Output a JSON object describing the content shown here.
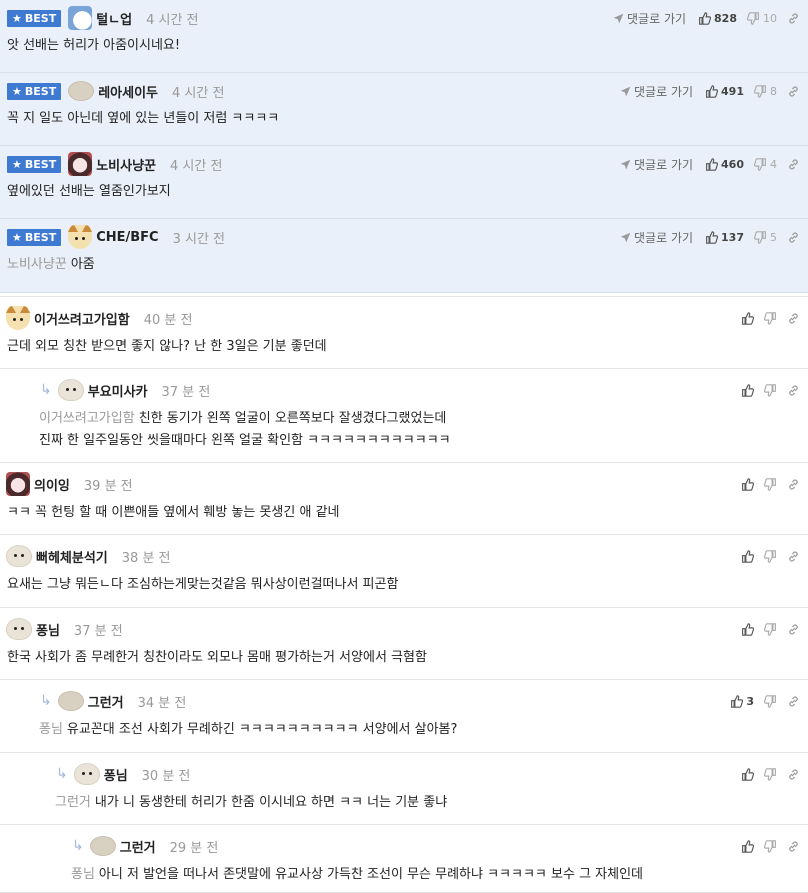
{
  "best_label": "BEST",
  "goto_label": "댓글로 가기",
  "best_comments": [
    {
      "nick": "털ㄴ업",
      "time": "4 시간 전",
      "up": "828",
      "down": "10",
      "text": "앗 선배는 허리가 아줌이시네요!",
      "mention": "",
      "avatar": "polar"
    },
    {
      "nick": "레아세이두",
      "time": "4 시간 전",
      "up": "491",
      "down": "8",
      "text": "꼭 지 일도 아닌데 옆에 있는 년들이 저럼 ㅋㅋㅋㅋ",
      "mention": "",
      "avatar": "blob"
    },
    {
      "nick": "노비사냥꾼",
      "time": "4 시간 전",
      "up": "460",
      "down": "4",
      "text": "옆에있던 선배는 열줌인가보지",
      "mention": "",
      "avatar": "doll"
    },
    {
      "nick": "CHE/BFC",
      "time": "3 시간 전",
      "up": "137",
      "down": "5",
      "text": "아줌",
      "mention": "노비사냥꾼",
      "avatar": "fox"
    }
  ],
  "comments": [
    {
      "nick": "이거쓰려고가입함",
      "time": "40 분 전",
      "text": "근데 외모 칭찬 받으면 좋지 않나? 난 한 3일은 기분 좋던데",
      "mention": "",
      "avatar": "fox",
      "depth": 0,
      "up": ""
    },
    {
      "nick": "부요미사카",
      "time": "37 분 전",
      "text": "친한 동기가 왼쪽 얼굴이 오른쪽보다 잘생겼다그랬었는데",
      "text2": "진짜 한 일주일동안 씻을때마다 왼쪽 얼굴 확인함 ㅋㅋㅋㅋㅋㅋㅋㅋㅋㅋㅋㅋ",
      "mention": "이거쓰려고가입함",
      "avatar": "puppy",
      "depth": 1,
      "up": ""
    },
    {
      "nick": "의이잉",
      "time": "39 분 전",
      "text": "ㅋㅋ 꼭 헌팅 할 때 이쁜애들 옆에서 훼방 놓는 못생긴 애 같네",
      "mention": "",
      "avatar": "doll",
      "depth": 0,
      "up": ""
    },
    {
      "nick": "뻐헤체분석기",
      "time": "38 분 전",
      "text": "요새는 그냥 뭐든ㄴ다 조심하는게맞는것같음 뭐사상이런걸떠나서 피곤함",
      "mention": "",
      "avatar": "puppy",
      "depth": 0,
      "up": ""
    },
    {
      "nick": "퐁님",
      "time": "37 분 전",
      "text": "한국 사회가 좀 무례한거 칭찬이라도 외모나 몸매 평가하는거 서양에서 극혐함",
      "mention": "",
      "avatar": "puppy",
      "depth": 0,
      "up": ""
    },
    {
      "nick": "그런거",
      "time": "34 분 전",
      "text": "유교꼰대 조선 사회가 무례하긴 ㅋㅋㅋㅋㅋㅋㅋㅋㅋㅋ 서양에서 살아봄?",
      "mention": "퐁님",
      "avatar": "blob",
      "depth": 1,
      "up": "3"
    },
    {
      "nick": "퐁님",
      "time": "30 분 전",
      "text": "내가 니 동생한테 허리가 한줌 이시네요 하면 ㅋㅋ 너는 기분 좋냐",
      "mention": "그런거",
      "avatar": "puppy",
      "depth": 2,
      "up": ""
    },
    {
      "nick": "그런거",
      "time": "29 분 전",
      "text": "아니 저 발언을 떠나서 존댓말에 유교사상 가득찬 조선이 무슨 무례하냐 ㅋㅋㅋㅋㅋ 보수 그 자체인데",
      "mention": "퐁님",
      "avatar": "blob",
      "depth": 3,
      "up": ""
    }
  ]
}
